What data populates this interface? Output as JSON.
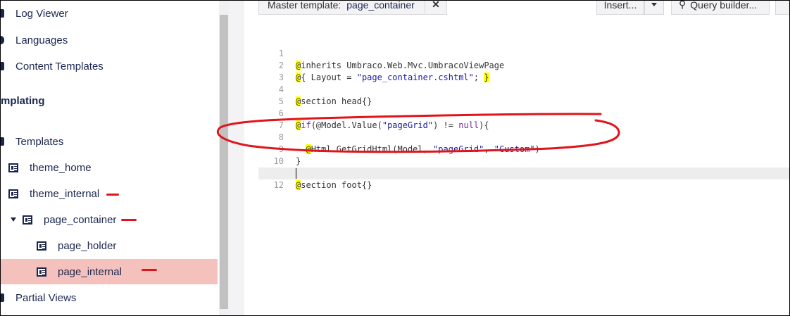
{
  "sidebar": {
    "items": [
      {
        "label": "Log Viewer"
      },
      {
        "label": "Languages"
      },
      {
        "label": "Content Templates"
      }
    ],
    "section_heading": "mplating",
    "templates": {
      "root_label": "Templates",
      "children": [
        {
          "label": "theme_home"
        },
        {
          "label": "theme_internal"
        },
        {
          "label": "page_container"
        },
        {
          "label": "page_holder"
        },
        {
          "label": "page_internal"
        }
      ]
    },
    "partial_views_label": "Partial Views"
  },
  "toolbar": {
    "master_template_label": "Master template:",
    "master_template_value": "page_container",
    "remove_icon": "close-icon",
    "insert_label": "Insert...",
    "query_builder_label": "Query builder..."
  },
  "editor": {
    "lines": [
      {
        "num": "1",
        "at": "@",
        "code": "inherits Umbraco.Web.Mvc.UmbracoViewPage"
      },
      {
        "num": "2",
        "at": "@",
        "pre": "{ Layout = ",
        "str": "\"page_container.cshtml\"",
        "post": "; ",
        "close": "}"
      },
      {
        "num": "3"
      },
      {
        "num": "4",
        "at": "@",
        "code": "section head{}"
      },
      {
        "num": "5"
      },
      {
        "num": "6",
        "at": "@",
        "kw1": "if",
        "pre": "(@Model.Value(",
        "str": "\"pageGrid\"",
        "mid": ") != ",
        "kw2": "null",
        "post": "){"
      },
      {
        "num": "7"
      },
      {
        "num": "8",
        "indent": "  ",
        "at": "@",
        "pre": "Html.GetGridHtml(Model, ",
        "str": "\"pageGrid\"",
        "mid": ", ",
        "str2": "\"Custom\"",
        "post": ")"
      },
      {
        "num": "9",
        "code": "}"
      },
      {
        "num": "10"
      },
      {
        "num": "11",
        "at": "@",
        "code": "section foot{}"
      },
      {
        "num": "12"
      }
    ]
  },
  "colors": {
    "selected_bg": "#f5c1bc",
    "annotation_red": "#e0141b",
    "nav_text": "#1b264f",
    "highlight": "#ffff00"
  }
}
